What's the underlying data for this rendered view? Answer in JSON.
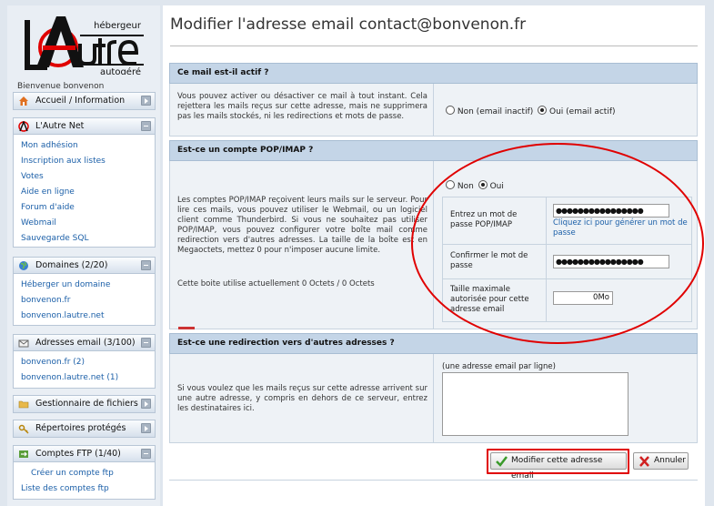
{
  "sidebar": {
    "welcome": "Bienvenue bonvenon",
    "logo": {
      "line1": "hébergeur",
      "line2": "autogéré",
      "mark": "l'Autre"
    },
    "home": {
      "label": "Accueil / Information"
    },
    "lautre_net": {
      "title": "L'Autre Net",
      "items": [
        "Mon adhésion",
        "Inscription aux listes",
        "Votes",
        "Aide en ligne",
        "Forum d'aide",
        "Webmail",
        "Sauvegarde SQL"
      ]
    },
    "domains": {
      "title": "Domaines (2/20)",
      "items": [
        "Héberger un domaine",
        "bonvenon.fr",
        "bonvenon.lautre.net"
      ]
    },
    "emails": {
      "title": "Adresses email (3/100)",
      "items": [
        "bonvenon.fr (2)",
        "bonvenon.lautre.net (1)"
      ]
    },
    "files": {
      "title": "Gestionnaire de fichiers"
    },
    "protected": {
      "title": "Répertoires protégés"
    },
    "ftp": {
      "title": "Comptes FTP (1/40)",
      "items": [
        "Créer un compte ftp",
        "Liste des comptes ftp"
      ]
    }
  },
  "main": {
    "title": "Modifier l'adresse email contact@bonvenon.fr",
    "active": {
      "heading": "Ce mail est-il actif ?",
      "description": "Vous pouvez activer ou désactiver ce mail à tout instant. Cela rejettera les mails reçus sur cette adresse, mais ne supprimera pas les mails stockés, ni les redirections et mots de passe.",
      "off_label": "Non (email inactif)",
      "on_label": "Oui (email actif)"
    },
    "pop": {
      "heading": "Est-ce un compte POP/IMAP ?",
      "description": "Les comptes POP/IMAP reçoivent leurs mails sur le serveur. Pour lire ces mails, vous pouvez utiliser le Webmail, ou un logiciel client comme Thunderbird. Si vous ne souhaitez pas utiliser POP/IMAP, vous pouvez configurer votre boîte mail comme redirection vers d'autres adresses. La taille de la boîte est en Megaoctets, mettez 0 pour n'imposer aucune limite.",
      "usage": "Cette boite utilise actuellement 0 Octets / 0 Octets",
      "no_label": "Non",
      "yes_label": "Oui",
      "password_label": "Entrez un mot de passe POP/IMAP",
      "password_value": "●●●●●●●●●●●●●●●●",
      "generate_link": "Cliquez ici pour générer un mot de passe",
      "confirm_label": "Confirmer le mot de passe",
      "confirm_value": "●●●●●●●●●●●●●●●●",
      "quota_label": "Taille maximale autorisée pour cette adresse email",
      "quota_value": "0Mo"
    },
    "redirect": {
      "heading": "Est-ce une redirection vers d'autres adresses ?",
      "description": "Si vous voulez que les mails reçus sur cette adresse arrivent sur une autre adresse, y compris en dehors de ce serveur, entrez les destinataires ici.",
      "hint": "(une adresse email par ligne)",
      "value": ""
    },
    "buttons": {
      "submit": "Modifier cette adresse email",
      "cancel": "Annuler"
    }
  },
  "colors": {
    "annotation": "#e00000",
    "section_header": "#c4d5e7",
    "link": "#1b5fa8"
  }
}
